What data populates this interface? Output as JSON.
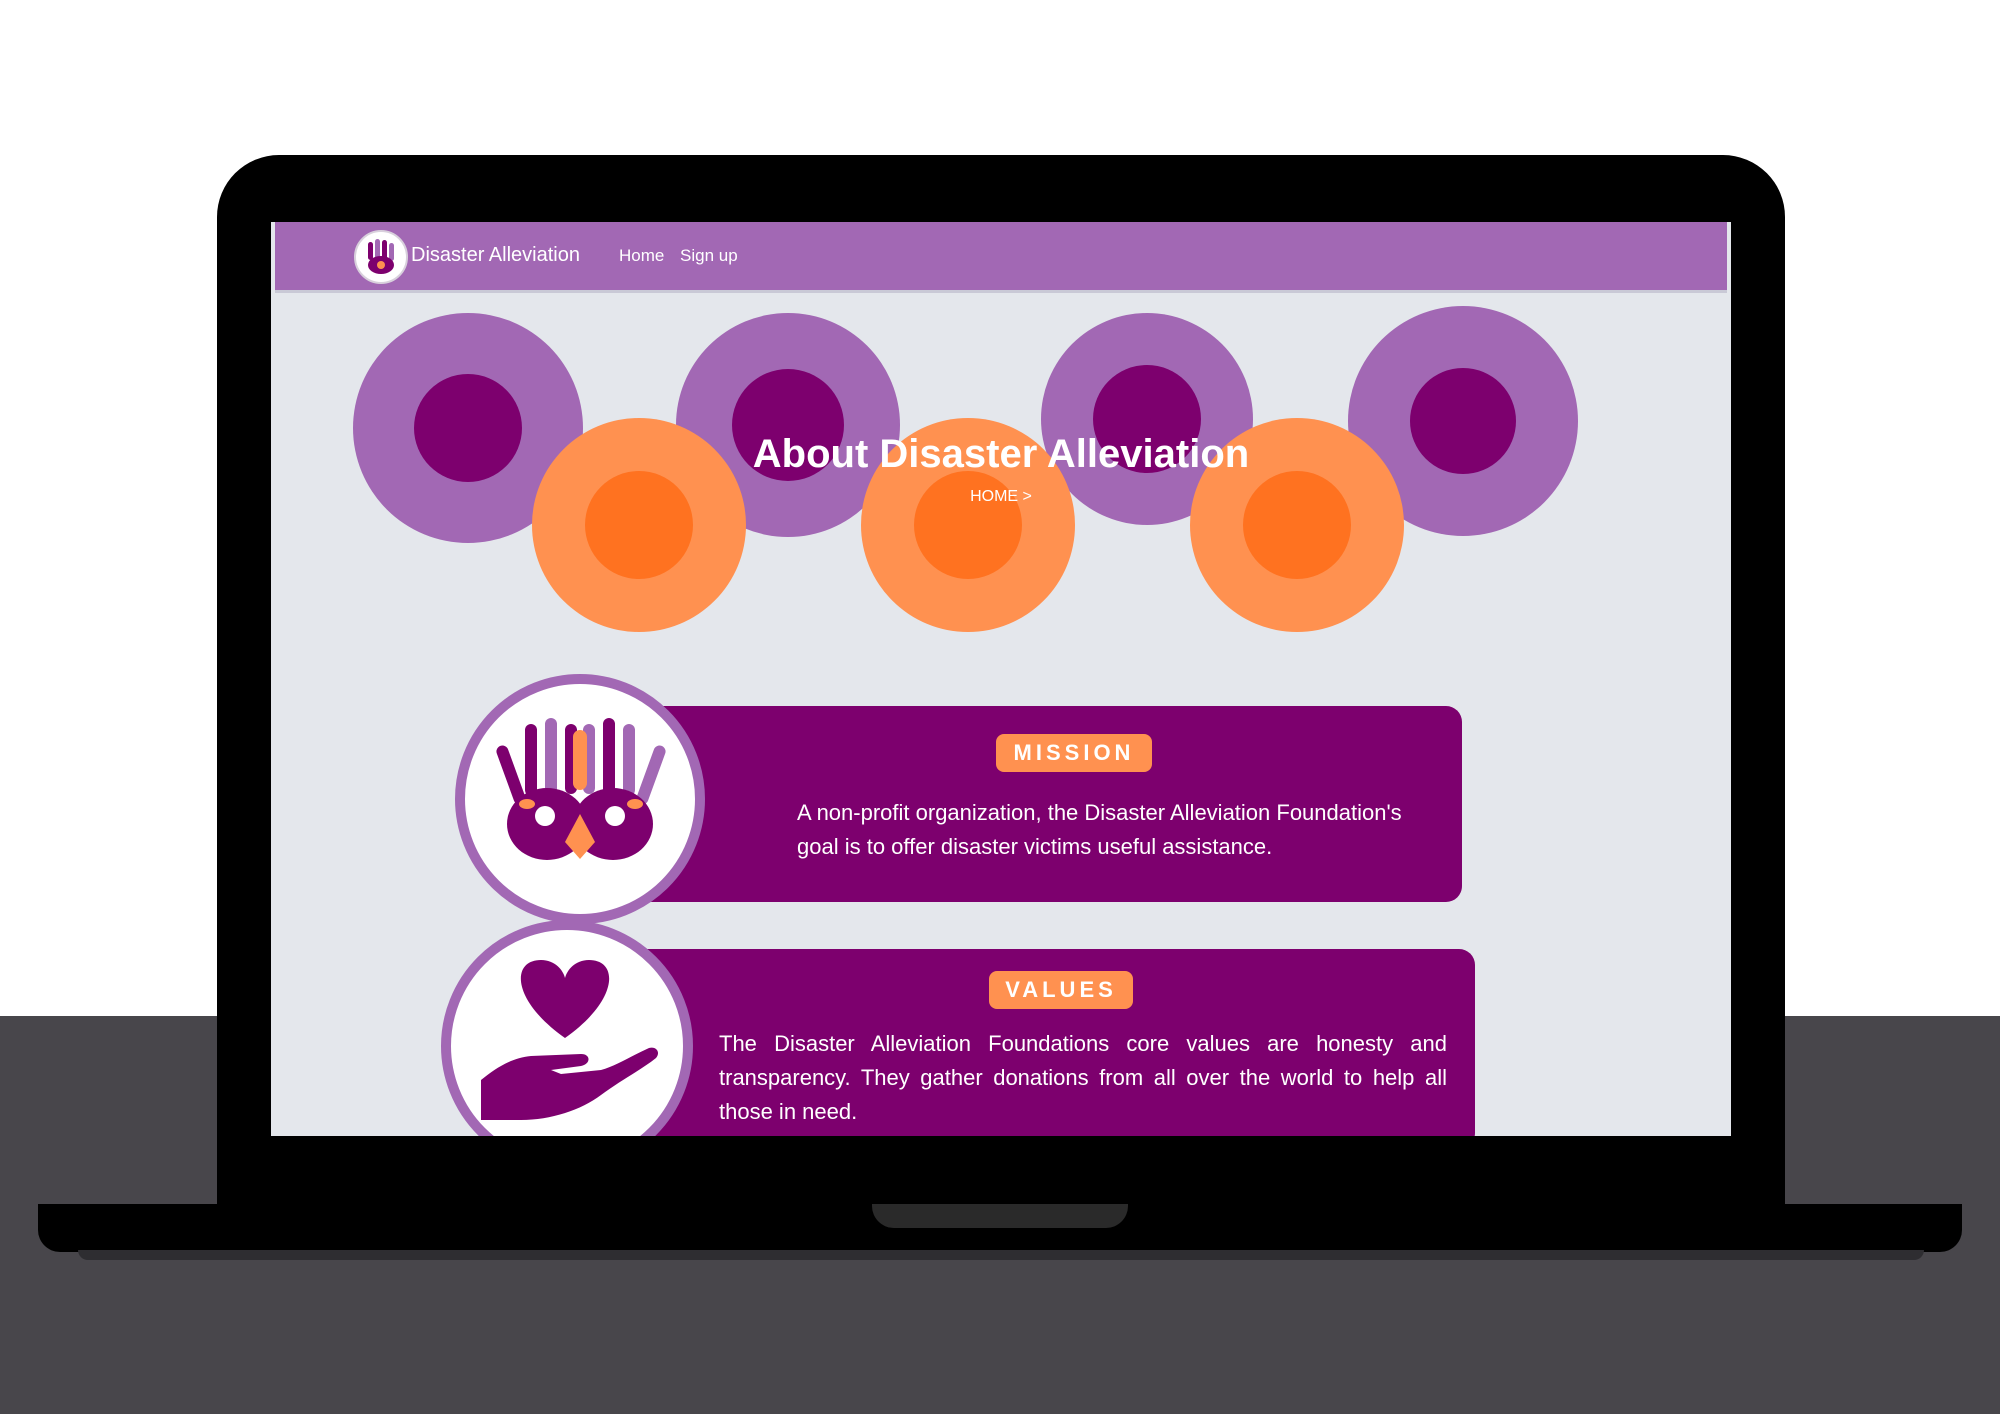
{
  "nav": {
    "brand": "Disaster Alleviation",
    "links": [
      "Home",
      "Sign up"
    ]
  },
  "hero": {
    "title": "About Disaster Alleviation",
    "breadcrumb": "HOME >"
  },
  "mission": {
    "label": "MISSION",
    "text": "A non-profit organization, the Disaster Alleviation Foundation's goal is to offer disaster victims useful assistance.",
    "icon": "handprints-icon"
  },
  "values": {
    "label": "VALUES",
    "text": "The Disaster Alleviation Foundations core values are honesty and transparency. They gather donations from all over the world to help all those in need.",
    "icon": "heart-in-hand-icon"
  },
  "colors": {
    "nav": "#a268b4",
    "card": "#7d006e",
    "accent": "#ff9150",
    "page_bg": "#e4e7ec"
  }
}
